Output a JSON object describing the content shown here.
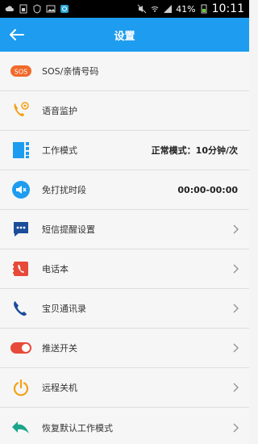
{
  "status_bar": {
    "battery_percent": "41%",
    "time": "10:11",
    "icons": [
      "cloud-icon",
      "sim-icon",
      "shield-icon",
      "image-icon",
      "app-icon",
      "mute-icon",
      "wifi-icon",
      "signal-icon",
      "battery-icon"
    ]
  },
  "app_bar": {
    "title": "设置",
    "back_icon": "arrow-left-icon"
  },
  "items": [
    {
      "label": "SOS/亲情号码",
      "icon": "sos-icon",
      "icon_text": "SOS",
      "value": "",
      "chevron": false
    },
    {
      "label": "语音监护",
      "icon": "phone-monitor-icon",
      "value": "",
      "chevron": false
    },
    {
      "label": "工作模式",
      "icon": "work-mode-icon",
      "value": "正常模式：10分钟/次",
      "chevron": false
    },
    {
      "label": "免打扰时段",
      "icon": "mute-speaker-icon",
      "value": "00:00-00:00",
      "chevron": false
    },
    {
      "label": "短信提醒设置",
      "icon": "sms-icon",
      "value": "",
      "chevron": true
    },
    {
      "label": "电话本",
      "icon": "phonebook-icon",
      "value": "",
      "chevron": true
    },
    {
      "label": "宝贝通讯录",
      "icon": "contacts-phone-icon",
      "value": "",
      "chevron": true
    },
    {
      "label": "推送开关",
      "icon": "toggle-icon",
      "value": "",
      "chevron": true
    },
    {
      "label": "远程关机",
      "icon": "power-icon",
      "value": "",
      "chevron": true
    },
    {
      "label": "恢复默认工作模式",
      "icon": "restore-icon",
      "value": "",
      "chevron": true
    }
  ],
  "colors": {
    "app_bar": "#1e9cef",
    "sos": "#f06a2a",
    "orange": "#f4a117",
    "blue": "#1e9cef",
    "dark_blue": "#1b4d9b",
    "red": "#e84a3a",
    "green": "#1aa58a"
  }
}
